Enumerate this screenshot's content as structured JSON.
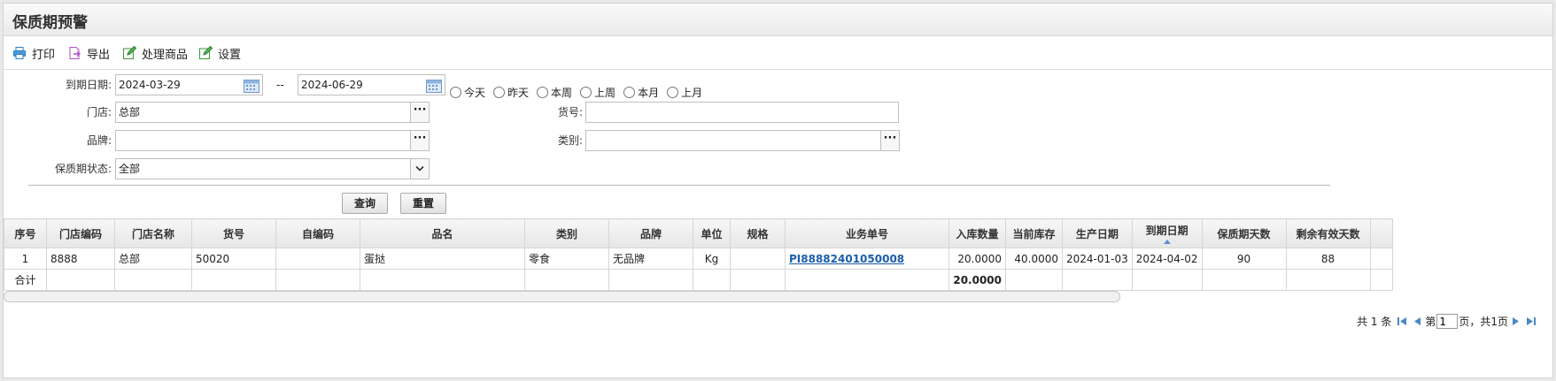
{
  "title": "保质期预警",
  "toolbar": {
    "print": "打印",
    "export": "导出",
    "process": "处理商品",
    "settings": "设置"
  },
  "filters": {
    "expiry_label": "到期日期:",
    "date_from": "2024-03-29",
    "date_to": "2024-06-29",
    "date_sep": "--",
    "quick_ranges": [
      "今天",
      "昨天",
      "本周",
      "上周",
      "本月",
      "上月"
    ],
    "store_label": "门店:",
    "store_value": "总部",
    "sku_label": "货号:",
    "sku_value": "",
    "brand_label": "品牌:",
    "brand_value": "",
    "category_label": "类别:",
    "category_value": "",
    "status_label": "保质期状态:",
    "status_value": "全部"
  },
  "buttons": {
    "query": "查询",
    "reset": "重置"
  },
  "table": {
    "headers": [
      "序号",
      "门店编码",
      "门店名称",
      "货号",
      "自编码",
      "品名",
      "类别",
      "品牌",
      "单位",
      "规格",
      "业务单号",
      "入库数量",
      "当前库存",
      "生产日期",
      "到期日期",
      "保质期天数",
      "剩余有效天数"
    ],
    "rows": [
      [
        "1",
        "8888",
        "总部",
        "50020",
        "",
        "蛋挞",
        "零食",
        "无品牌",
        "Kg",
        "",
        "PI88882401050008",
        "20.0000",
        "40.0000",
        "2024-01-03",
        "2024-04-02",
        "90",
        "88"
      ]
    ],
    "footer_label": "合计",
    "footer_total_qty": "20.0000"
  },
  "pager": {
    "total": "共 1 条",
    "page_prefix": "第",
    "page": "1",
    "page_suffix": "页，共1页"
  }
}
